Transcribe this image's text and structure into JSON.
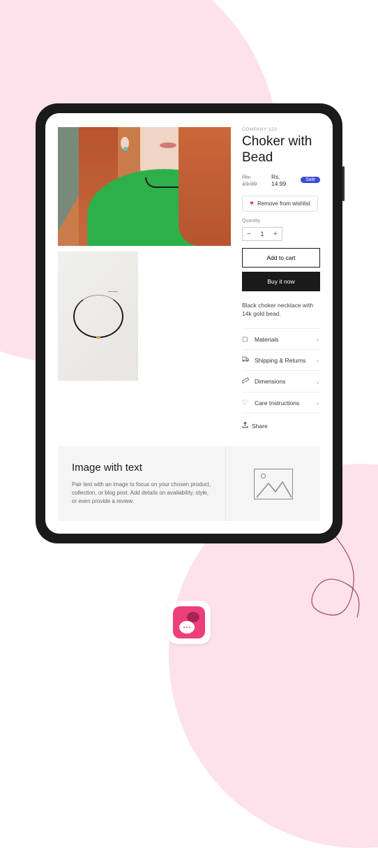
{
  "product": {
    "vendor": "COMPANY 123",
    "title": "Choker with Bead",
    "old_price": "Rs. 19.99",
    "new_price": "Rs. 14.99",
    "sale_label": "Sale",
    "wishlist_label": "Remove from wishlist",
    "quantity_label": "Quantity",
    "quantity_value": "1",
    "add_to_cart": "Add to cart",
    "buy_now": "Buy it now",
    "description": "Black choker necklace with 14k gold bead."
  },
  "accordion": [
    {
      "label": "Materials"
    },
    {
      "label": "Shipping & Returns"
    },
    {
      "label": "Dimensions"
    },
    {
      "label": "Care Instructions"
    }
  ],
  "share_label": "Share",
  "iwt": {
    "title": "Image with text",
    "body": "Pair text with an image to focus on your chosen product, collection, or blog post. Add details on availability, style, or even provide a review."
  }
}
